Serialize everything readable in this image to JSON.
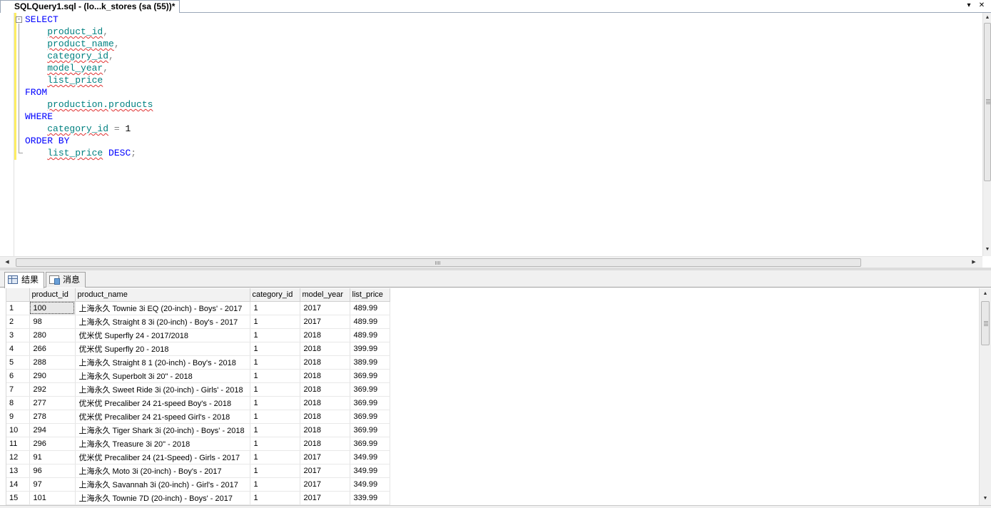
{
  "tab": {
    "title": "SQLQuery1.sql - (lo...k_stores (sa (55))*",
    "dropdown_glyph": "▾",
    "close_glyph": "✕"
  },
  "editor": {
    "collapse_glyph": "-",
    "lines": [
      [
        {
          "t": "SELECT",
          "c": "kw"
        }
      ],
      [
        {
          "t": "    "
        },
        {
          "t": "product_id",
          "c": "id"
        },
        {
          "t": ",",
          "c": "punc"
        }
      ],
      [
        {
          "t": "    "
        },
        {
          "t": "product_name",
          "c": "id"
        },
        {
          "t": ",",
          "c": "punc"
        }
      ],
      [
        {
          "t": "    "
        },
        {
          "t": "category_id",
          "c": "id"
        },
        {
          "t": ",",
          "c": "punc"
        }
      ],
      [
        {
          "t": "    "
        },
        {
          "t": "model_year",
          "c": "id"
        },
        {
          "t": ",",
          "c": "punc"
        }
      ],
      [
        {
          "t": "    "
        },
        {
          "t": "list_price",
          "c": "id"
        }
      ],
      [
        {
          "t": "FROM",
          "c": "kw"
        }
      ],
      [
        {
          "t": "    "
        },
        {
          "t": "production.products",
          "c": "id"
        }
      ],
      [
        {
          "t": "WHERE",
          "c": "kw"
        }
      ],
      [
        {
          "t": "    "
        },
        {
          "t": "category_id",
          "c": "id"
        },
        {
          "t": " = ",
          "c": "op"
        },
        {
          "t": "1",
          "c": "num"
        }
      ],
      [
        {
          "t": "ORDER BY",
          "c": "kw"
        }
      ],
      [
        {
          "t": "    "
        },
        {
          "t": "list_price",
          "c": "id"
        },
        {
          "t": " "
        },
        {
          "t": "DESC",
          "c": "kw"
        },
        {
          "t": ";",
          "c": "punc"
        }
      ]
    ]
  },
  "results_tabs": {
    "results_label": "结果",
    "messages_label": "消息"
  },
  "grid": {
    "columns": [
      "product_id",
      "product_name",
      "category_id",
      "model_year",
      "list_price"
    ],
    "rows": [
      [
        "1",
        "100",
        "上海永久 Townie 3i EQ (20-inch) - Boys' - 2017",
        "1",
        "2017",
        "489.99"
      ],
      [
        "2",
        "98",
        "上海永久 Straight 8 3i (20-inch) - Boy's - 2017",
        "1",
        "2017",
        "489.99"
      ],
      [
        "3",
        "280",
        "优米优 Superfly 24 - 2017/2018",
        "1",
        "2018",
        "489.99"
      ],
      [
        "4",
        "266",
        "优米优 Superfly 20 - 2018",
        "1",
        "2018",
        "399.99"
      ],
      [
        "5",
        "288",
        "上海永久 Straight 8 1 (20-inch) - Boy's - 2018",
        "1",
        "2018",
        "389.99"
      ],
      [
        "6",
        "290",
        "上海永久 Superbolt 3i 20\" - 2018",
        "1",
        "2018",
        "369.99"
      ],
      [
        "7",
        "292",
        "上海永久 Sweet Ride 3i (20-inch) - Girls' - 2018",
        "1",
        "2018",
        "369.99"
      ],
      [
        "8",
        "277",
        "优米优 Precaliber 24 21-speed Boy's - 2018",
        "1",
        "2018",
        "369.99"
      ],
      [
        "9",
        "278",
        "优米优 Precaliber 24 21-speed Girl's - 2018",
        "1",
        "2018",
        "369.99"
      ],
      [
        "10",
        "294",
        "上海永久 Tiger Shark 3i (20-inch) - Boys' - 2018",
        "1",
        "2018",
        "369.99"
      ],
      [
        "11",
        "296",
        "上海永久 Treasure 3i 20\" - 2018",
        "1",
        "2018",
        "369.99"
      ],
      [
        "12",
        "91",
        "优米优 Precaliber 24 (21-Speed) - Girls - 2017",
        "1",
        "2017",
        "349.99"
      ],
      [
        "13",
        "96",
        "上海永久 Moto 3i (20-inch) - Boy's - 2017",
        "1",
        "2017",
        "349.99"
      ],
      [
        "14",
        "97",
        "上海永久 Savannah 3i (20-inch) - Girl's - 2017",
        "1",
        "2017",
        "349.99"
      ],
      [
        "15",
        "101",
        "上海永久 Townie 7D (20-inch) - Boys' - 2017",
        "1",
        "2017",
        "339.99"
      ]
    ]
  },
  "scroll": {
    "up": "▲",
    "down": "▼",
    "left": "◀",
    "right": "▶"
  }
}
